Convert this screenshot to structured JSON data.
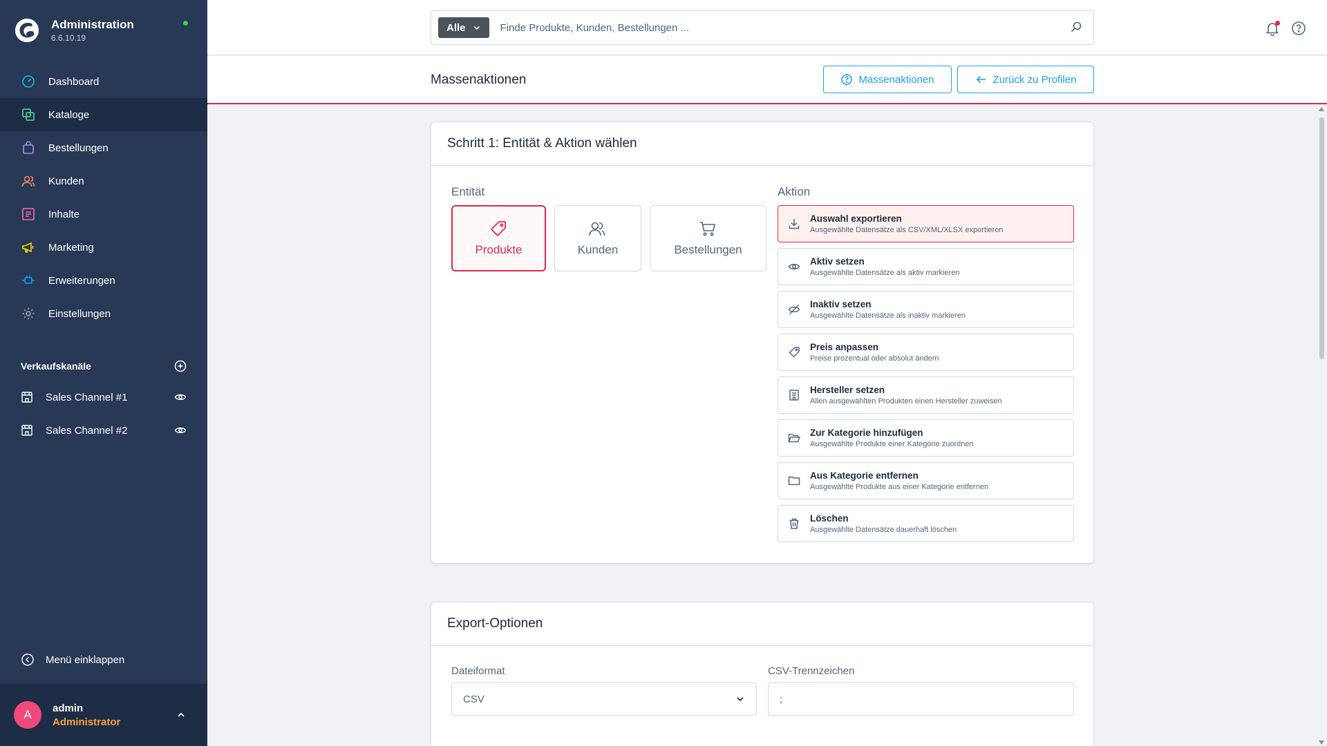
{
  "app": {
    "title": "Administration",
    "version": "6.6.10.19"
  },
  "sidebar": {
    "items": [
      {
        "label": "Dashboard",
        "icon": "dashboard-icon",
        "color": "#1cb7e8"
      },
      {
        "label": "Kataloge",
        "icon": "catalog-icon",
        "color": "#57d9a3"
      },
      {
        "label": "Bestellungen",
        "icon": "shopping-bag-icon",
        "color": "#a092f0"
      },
      {
        "label": "Kunden",
        "icon": "users-icon",
        "color": "#f88962"
      },
      {
        "label": "Inhalte",
        "icon": "content-icon",
        "color": "#ff68b4"
      },
      {
        "label": "Marketing",
        "icon": "megaphone-icon",
        "color": "#ffd700"
      },
      {
        "label": "Erweiterungen",
        "icon": "plug-icon",
        "color": "#189eff"
      },
      {
        "label": "Einstellungen",
        "icon": "gear-icon",
        "color": "#9aa8b5"
      }
    ],
    "channels_heading": "Verkaufskanäle",
    "channels": [
      {
        "label": "Sales Channel #1"
      },
      {
        "label": "Sales Channel #2"
      }
    ],
    "collapse_label": "Menü einklappen",
    "user": {
      "initial": "A",
      "name": "admin",
      "role": "Administrator"
    }
  },
  "header": {
    "search_filter": "Alle",
    "search_placeholder": "Finde Produkte, Kunden, Bestellungen ..."
  },
  "smartbar": {
    "title": "Massenaktionen",
    "help_button": "Massenaktionen",
    "back_button": "Zurück zu Profilen"
  },
  "step1": {
    "title": "Schritt 1: Entität & Aktion wählen",
    "entity_label": "Entität",
    "action_label": "Aktion",
    "entities": [
      {
        "label": "Produkte",
        "icon": "tag-icon"
      },
      {
        "label": "Kunden",
        "icon": "users-icon"
      },
      {
        "label": "Bestellungen",
        "icon": "cart-icon"
      }
    ],
    "actions": [
      {
        "title": "Auswahl exportieren",
        "desc": "Ausgewählte Datensätze als CSV/XML/XLSX exportieren",
        "icon": "download-icon"
      },
      {
        "title": "Aktiv setzen",
        "desc": "Ausgewählte Datensätze als aktiv markieren",
        "icon": "eye-icon"
      },
      {
        "title": "Inaktiv setzen",
        "desc": "Ausgewählte Datensätze als inaktiv markieren",
        "icon": "eye-slash-icon"
      },
      {
        "title": "Preis anpassen",
        "desc": "Preise prozentual oder absolut ändern",
        "icon": "tag-icon"
      },
      {
        "title": "Hersteller setzen",
        "desc": "Allen ausgewählten Produkten einen Hersteller zuweisen",
        "icon": "building-icon"
      },
      {
        "title": "Zur Kategorie hinzufügen",
        "desc": "Ausgewählte Produkte einer Kategorie zuordnen",
        "icon": "folder-open-icon"
      },
      {
        "title": "Aus Kategorie entfernen",
        "desc": "Ausgewählte Produkte aus einer Kategorie entfernen",
        "icon": "folder-icon"
      },
      {
        "title": "Löschen",
        "desc": "Ausgewählte Datensätze dauerhaft löschen",
        "icon": "trash-icon"
      }
    ]
  },
  "export": {
    "title": "Export-Optionen",
    "format_label": "Dateiformat",
    "format_value": "CSV",
    "separator_label": "CSV-Trennzeichen",
    "separator_value": ";"
  },
  "colors": {
    "accent": "#189eff",
    "danger": "#de294c",
    "sidebar": "#273954"
  }
}
